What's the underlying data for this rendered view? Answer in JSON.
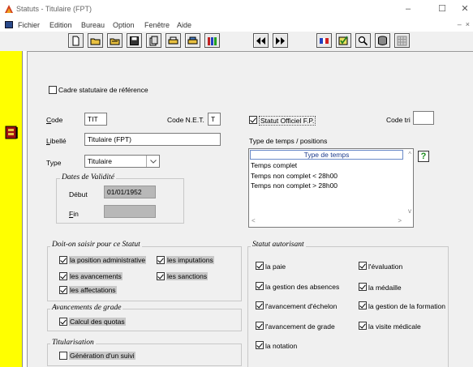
{
  "window": {
    "title": "Statuts - Titulaire (FPT)",
    "minimize": "–",
    "maximize": "☐",
    "close": "✕"
  },
  "menu": {
    "items": [
      "Fichier",
      "Edition",
      "Bureau",
      "Option",
      "Fenêtre",
      "Aide"
    ],
    "right_controls": "– ⁡ ×"
  },
  "toolbar": {
    "buttons": [
      "new-document",
      "open-folder",
      "open-folder-2",
      "save",
      "copy",
      "print",
      "print-preview",
      "books",
      "first-record",
      "next-record",
      "flag",
      "validate",
      "search",
      "database",
      "grid"
    ]
  },
  "form": {
    "cadre_reference": {
      "label": "Cadre statutaire de référence",
      "checked": false
    },
    "code": {
      "label": "Code",
      "value": "TIT"
    },
    "code_net": {
      "label": "Code N.E.T.",
      "value": "T"
    },
    "statut_officiel": {
      "label": "Statut Officiel F.P.",
      "checked": true
    },
    "code_tri": {
      "label": "Code tri",
      "value": ""
    },
    "libelle": {
      "label": "Libellé",
      "value": "Titulaire (FPT)"
    },
    "type": {
      "label": "Type",
      "value": "Titulaire"
    },
    "dates": {
      "title": "Dates de Validité",
      "debut_label": "Début",
      "debut_value": "01/01/1952",
      "fin_label": "Fin",
      "fin_value": ""
    },
    "temps": {
      "title": "Type de temps / positions",
      "header": "Type de temps",
      "rows": [
        "Temps complet",
        "Temps non complet < 28h00",
        "Temps non complet > 28h00"
      ],
      "help": "?"
    }
  },
  "saisir": {
    "title": "Doit-on saisir pour ce Statut",
    "items": [
      {
        "label": "la position administrative",
        "checked": true
      },
      {
        "label": "les imputations",
        "checked": true
      },
      {
        "label": "les avancements",
        "checked": true
      },
      {
        "label": "les sanctions",
        "checked": true
      },
      {
        "label": "les affectations",
        "checked": true
      }
    ]
  },
  "avancements": {
    "title": "Avancements de grade",
    "items": [
      {
        "label": "Calcul des quotas",
        "checked": true
      }
    ]
  },
  "titularisation": {
    "title": "Titularisation",
    "items": [
      {
        "label": "Génération d'un suivi",
        "checked": false
      }
    ]
  },
  "autorisant": {
    "title": "Statut autorisant",
    "items": [
      {
        "label": "la paie",
        "checked": true
      },
      {
        "label": "l'évaluation",
        "checked": true
      },
      {
        "label": "la gestion des absences",
        "checked": true
      },
      {
        "label": "la médaille",
        "checked": true
      },
      {
        "label": "l'avancement d'échelon",
        "checked": true
      },
      {
        "label": "la gestion de la formation",
        "checked": true
      },
      {
        "label": "l'avancement de grade",
        "checked": true
      },
      {
        "label": "la visite médicale",
        "checked": true
      },
      {
        "label": "la notation",
        "checked": true
      }
    ]
  },
  "colors": {
    "strip": "#ffff00",
    "panel": "#f0f0f0",
    "list_header": "#1e3c8c",
    "help_green": "#1a8a1a"
  }
}
